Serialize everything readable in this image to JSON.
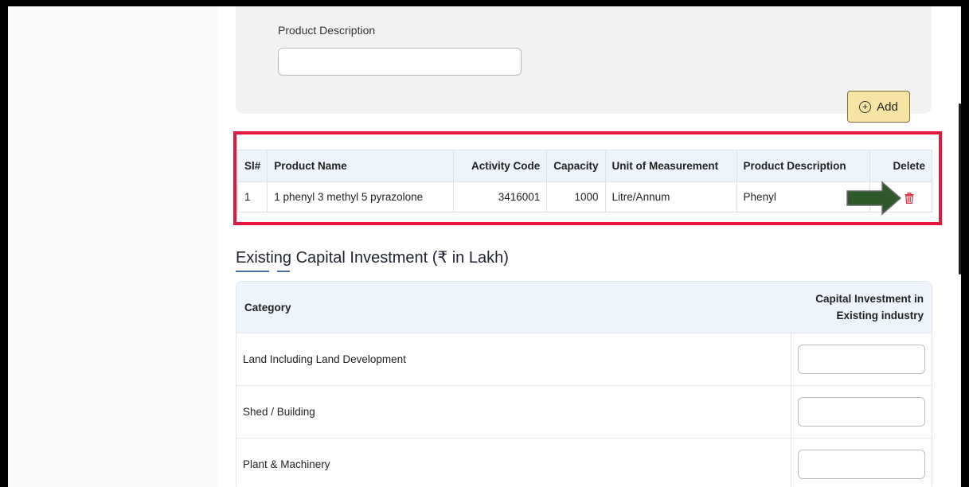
{
  "form": {
    "product_description_label": "Product Description",
    "product_description_value": "",
    "add_button_label": "Add",
    "add_icon": "plus-circle-icon"
  },
  "product_table": {
    "headers": {
      "sl": "Sl#",
      "product_name": "Product Name",
      "activity_code": "Activity Code",
      "capacity": "Capacity",
      "unit": "Unit of Measurement",
      "description": "Product Description",
      "delete": "Delete"
    },
    "rows": [
      {
        "sl": "1",
        "product_name": "1 phenyl 3 methyl 5 pyrazolone",
        "activity_code": "3416001",
        "capacity": "1000",
        "unit": "Litre/Annum",
        "description": "Phenyl",
        "delete_icon": "trash-icon"
      }
    ]
  },
  "capital_investment": {
    "title": "Existing Capital Investment (₹ in Lakh)",
    "headers": {
      "category": "Category",
      "investment": "Capital Investment in Existing industry"
    },
    "rows": [
      {
        "category": "Land Including Land Development",
        "value": ""
      },
      {
        "category": "Shed / Building",
        "value": ""
      },
      {
        "category": "Plant & Machinery",
        "value": ""
      }
    ]
  },
  "colors": {
    "highlight": "#e5173a",
    "arrow": "#2e5a2b",
    "trash": "#e0303f",
    "add_button": "#f7e4a4",
    "header_bg": "#eef4fb"
  }
}
